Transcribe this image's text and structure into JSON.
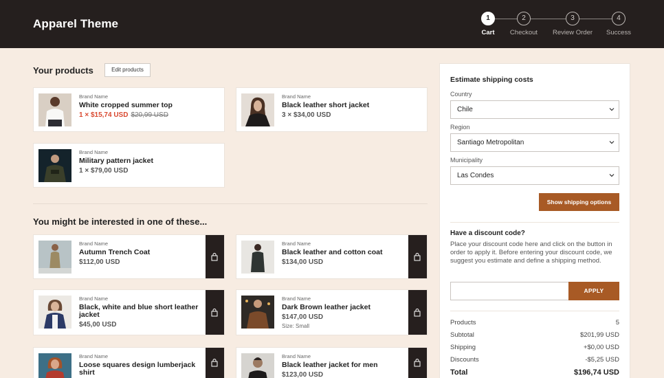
{
  "header": {
    "brand": "Apparel Theme",
    "steps": [
      {
        "num": "1",
        "label": "Cart"
      },
      {
        "num": "2",
        "label": "Checkout"
      },
      {
        "num": "3",
        "label": "Review Order"
      },
      {
        "num": "4",
        "label": "Success"
      }
    ]
  },
  "cart": {
    "title": "Your products",
    "edit_label": "Edit products",
    "items": [
      {
        "brand": "Brand Name",
        "name": "White cropped summer top",
        "price": "1 × $15,74 USD",
        "old_price": "$20,99 USD"
      },
      {
        "brand": "Brand Name",
        "name": "Black leather short jacket",
        "price": "3 × $34,00 USD"
      },
      {
        "brand": "Brand Name",
        "name": "Military pattern jacket",
        "price": "1 × $79,00 USD"
      }
    ]
  },
  "suggestions": {
    "title": "You might be interested in one of these...",
    "items": [
      {
        "brand": "Brand Name",
        "name": "Autumn Trench Coat",
        "price": "$112,00 USD"
      },
      {
        "brand": "Brand Name",
        "name": "Black leather and cotton coat",
        "price": "$134,00 USD"
      },
      {
        "brand": "Brand Name",
        "name": "Black, white and blue short leather jacket",
        "price": "$45,00 USD"
      },
      {
        "brand": "Brand Name",
        "name": "Dark Brown leather jacket",
        "price": "$147,00 USD",
        "size": "Size: Small"
      },
      {
        "brand": "Brand Name",
        "name": "Loose squares design lumberjack shirt",
        "price": ""
      },
      {
        "brand": "Brand Name",
        "name": "Black leather jacket for men",
        "price": "$123,00 USD"
      }
    ]
  },
  "shipping": {
    "title": "Estimate shipping costs",
    "country_label": "Country",
    "country_value": "Chile",
    "region_label": "Region",
    "region_value": "Santiago Metropolitan",
    "municipality_label": "Municipality",
    "municipality_value": "Las Condes",
    "button_label": "Show shipping options"
  },
  "discount": {
    "title": "Have a discount code?",
    "description": "Place your discount code here and click on the button in order to apply it. Before entering your discount code, we suggest you estimate and define a shipping method.",
    "input_value": "",
    "apply_label": "APPLY"
  },
  "summary": {
    "rows": [
      {
        "label": "Products",
        "value": "5"
      },
      {
        "label": "Subtotal",
        "value": "$201,99 USD"
      },
      {
        "label": "Shipping",
        "value": "+$0,00 USD"
      },
      {
        "label": "Discounts",
        "value": "-$5,25 USD"
      },
      {
        "label": "Total",
        "value": "$196,74 USD"
      }
    ]
  },
  "colors": {
    "header_bg": "#251f1e",
    "page_bg": "#f7ece2",
    "accent": "#a85a25",
    "sale": "#d9482f"
  },
  "icons": {
    "bag": "shopping-bag-icon",
    "chevron": "chevron-down-icon"
  }
}
